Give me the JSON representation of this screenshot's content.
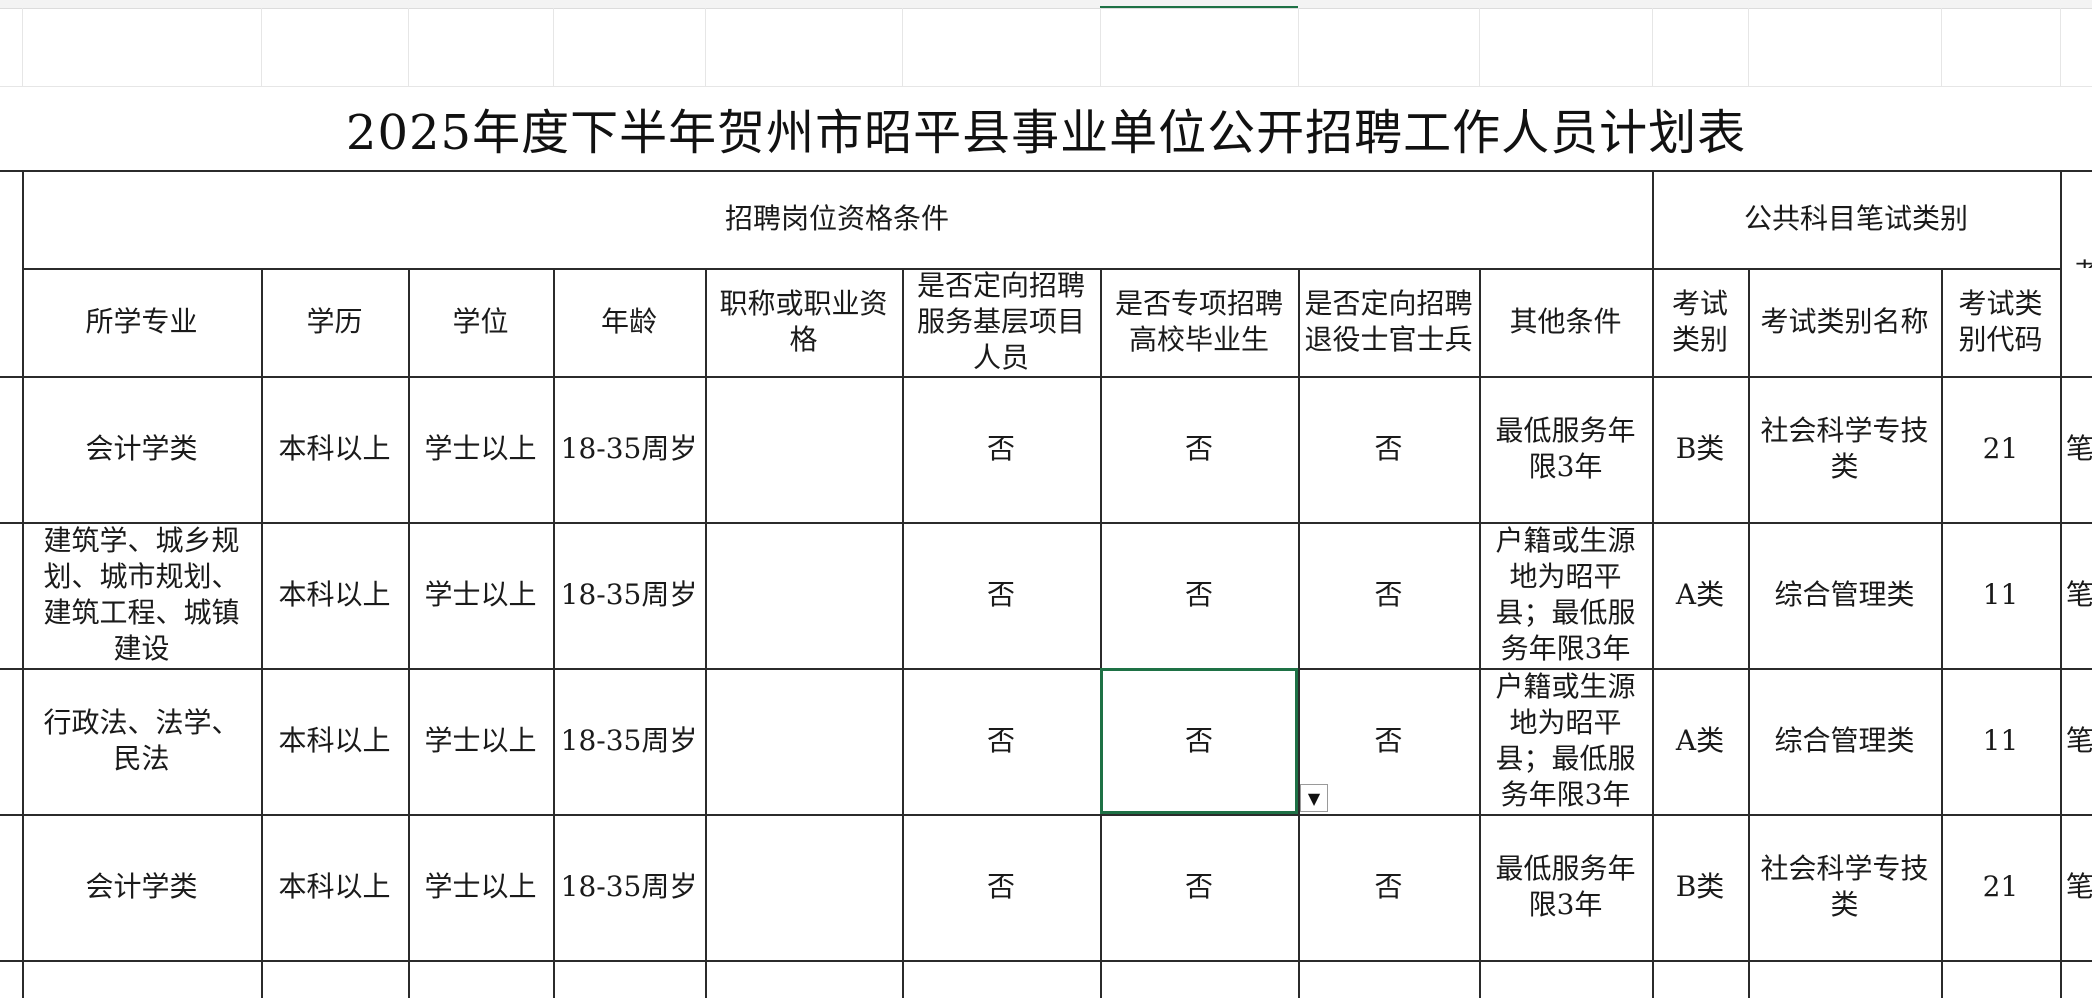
{
  "title": "2025年度下半年贺州市昭平县事业单位公开招聘工作人员计划表",
  "groups": {
    "qualifications": "招聘岗位资格条件",
    "written_exam": "公共科目笔试类别",
    "clipped_right": "考"
  },
  "columns": {
    "major": "所学专业",
    "education": "学历",
    "degree": "学位",
    "age": "年龄",
    "title_cert": "职称或职业资格",
    "grassroots": "是否定向招聘服务基层项目人员",
    "graduates": "是否专项招聘高校毕业生",
    "veterans": "是否定向招聘退役士官士兵",
    "other": "其他条件",
    "exam_type": "考试类别",
    "exam_name": "考试类别名称",
    "exam_code": "考试类别代码"
  },
  "rows": [
    {
      "major": "会计学类",
      "education": "本科以上",
      "degree": "学士以上",
      "age": "18-35周岁",
      "title_cert": "",
      "grassroots": "否",
      "graduates": "否",
      "veterans": "否",
      "other": "最低服务年限3年",
      "exam_type": "B类",
      "exam_name": "社会科学专技类",
      "exam_code": "21",
      "clipped": "笔"
    },
    {
      "major": "建筑学、城乡规划、城市规划、建筑工程、城镇建设",
      "education": "本科以上",
      "degree": "学士以上",
      "age": "18-35周岁",
      "title_cert": "",
      "grassroots": "否",
      "graduates": "否",
      "veterans": "否",
      "other": "户籍或生源地为昭平县；最低服务年限3年",
      "exam_type": "A类",
      "exam_name": "综合管理类",
      "exam_code": "11",
      "clipped": "笔"
    },
    {
      "major": "行政法、法学、民法",
      "education": "本科以上",
      "degree": "学士以上",
      "age": "18-35周岁",
      "title_cert": "",
      "grassroots": "否",
      "graduates": "否",
      "veterans": "否",
      "other": "户籍或生源地为昭平县；最低服务年限3年",
      "exam_type": "A类",
      "exam_name": "综合管理类",
      "exam_code": "11",
      "clipped": "笔"
    },
    {
      "major": "会计学类",
      "education": "本科以上",
      "degree": "学士以上",
      "age": "18-35周岁",
      "title_cert": "",
      "grassroots": "否",
      "graduates": "否",
      "veterans": "否",
      "other": "最低服务年限3年",
      "exam_type": "B类",
      "exam_name": "社会科学专技类",
      "exam_code": "21",
      "clipped": "笔"
    }
  ],
  "dropdown_arrow": "▼"
}
